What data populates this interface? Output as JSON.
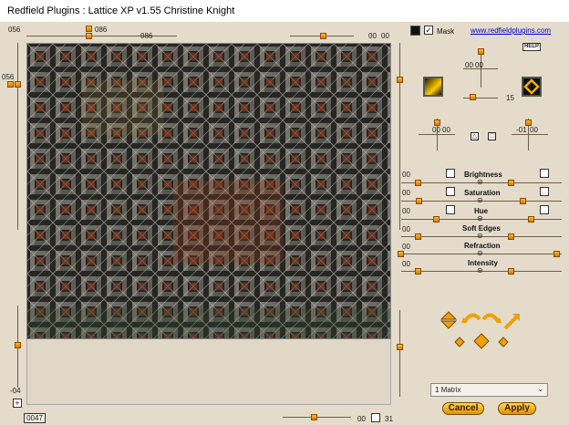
{
  "window": {
    "title": "Redfield Plugins : Lattice XP v1.55   Christine Knight"
  },
  "top": {
    "left_value": "056",
    "slider_value": "086",
    "slider_value2": "086",
    "right_values": [
      "00",
      "00"
    ]
  },
  "left": {
    "top_value": "056",
    "bottom_value": "-04"
  },
  "bottom": {
    "code": "0047",
    "right_value": "00",
    "right_value2": "31"
  },
  "header": {
    "mask_label": "Mask",
    "website_link": "www.redfieldplugins.com",
    "help_label": "HELP"
  },
  "light": {
    "values_a": [
      "00",
      "00"
    ],
    "value_15": "15"
  },
  "position": {
    "left": [
      "00",
      "00"
    ],
    "right": [
      "-01",
      "00"
    ]
  },
  "adjust": [
    {
      "label": "Brightness",
      "left": "00"
    },
    {
      "label": "Saturation",
      "left": "00"
    },
    {
      "label": "Hue",
      "left": "00"
    },
    {
      "label": "Soft Edges",
      "left": "00"
    },
    {
      "label": "Refraction",
      "left": "00"
    },
    {
      "label": "Intensity",
      "left": "00"
    }
  ],
  "preset": {
    "selected": "1 Matrix"
  },
  "actions": {
    "cancel": "Cancel",
    "apply": "Apply"
  },
  "colors": {
    "accent": "#f0a000",
    "panel": "#e4dbcb",
    "link": "#0000cc"
  }
}
